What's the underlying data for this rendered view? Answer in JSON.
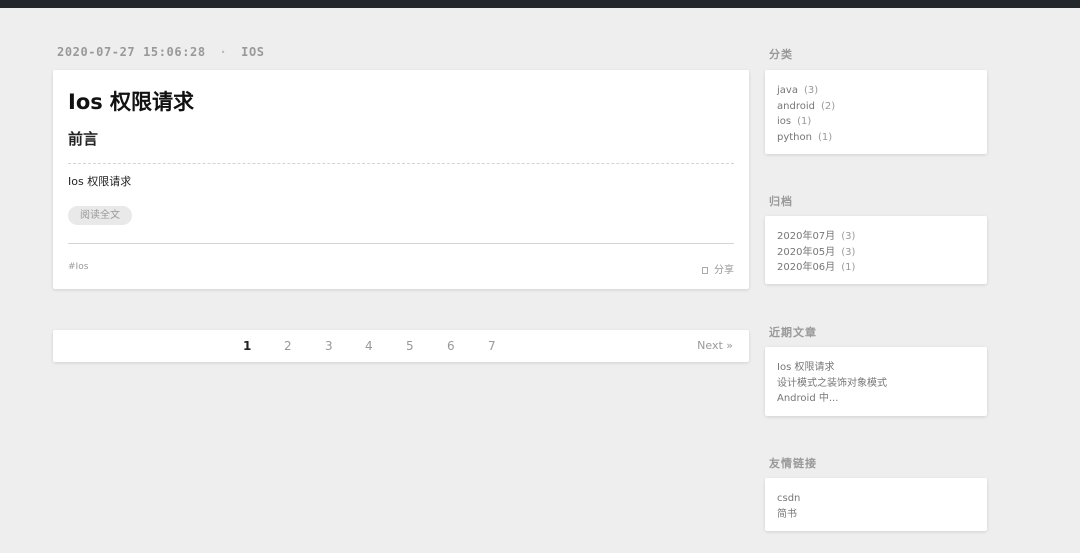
{
  "post": {
    "date": "2020-07-27 15:06:28",
    "separator": "·",
    "category": "IOS",
    "title": "Ios 权限请求",
    "subheading": "前言",
    "excerpt": "Ios 权限请求",
    "read_more_label": "阅读全文",
    "tag": "#Ios",
    "share_label": "分享"
  },
  "pagination": {
    "pages": [
      "1",
      "2",
      "3",
      "4",
      "5",
      "6",
      "7"
    ],
    "current": "1",
    "next_label": "Next »"
  },
  "sidebar": {
    "categories": {
      "title": "分类",
      "items": [
        {
          "label": "java",
          "count": "(3)"
        },
        {
          "label": "android",
          "count": "(2)"
        },
        {
          "label": "ios",
          "count": "(1)"
        },
        {
          "label": "python",
          "count": "(1)"
        }
      ]
    },
    "archives": {
      "title": "归档",
      "items": [
        {
          "label": "2020年07月",
          "count": "(3)"
        },
        {
          "label": "2020年05月",
          "count": "(3)"
        },
        {
          "label": "2020年06月",
          "count": "(1)"
        }
      ]
    },
    "recent_posts": {
      "title": "近期文章",
      "items": [
        {
          "label": "Ios 权限请求"
        },
        {
          "label": "设计模式之装饰对象模式"
        },
        {
          "label": "Android 中..."
        }
      ]
    },
    "links": {
      "title": "友情链接",
      "items": [
        {
          "label": "csdn"
        },
        {
          "label": "简书"
        }
      ]
    }
  }
}
